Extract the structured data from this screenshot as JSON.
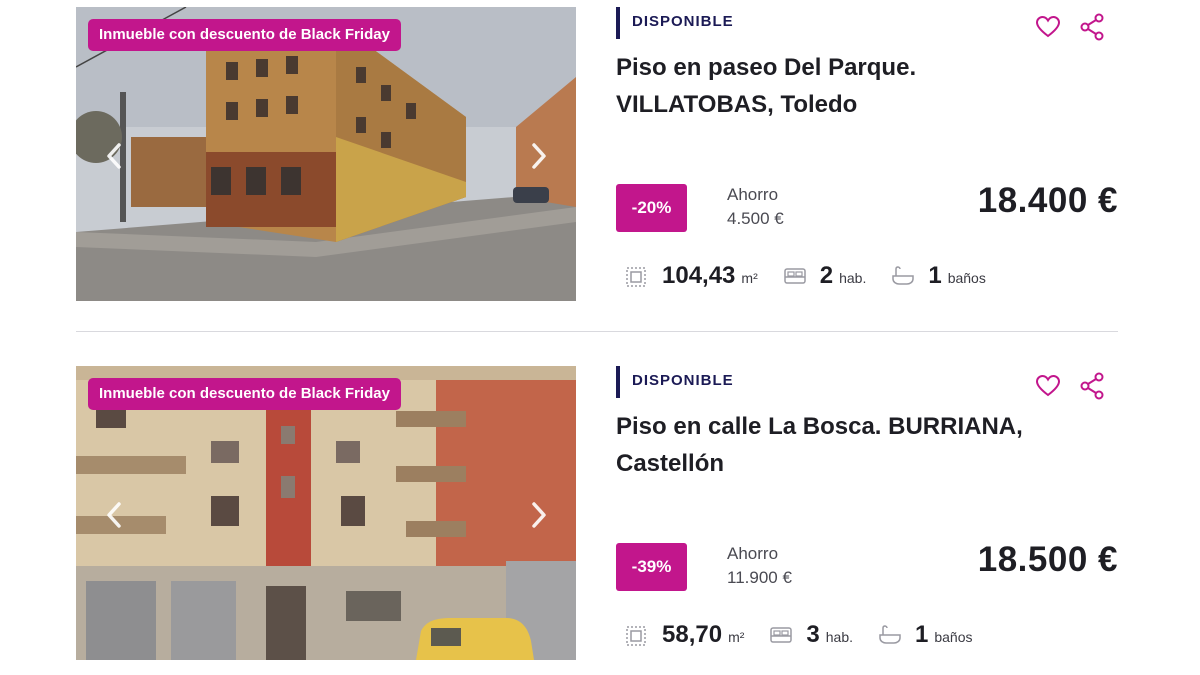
{
  "colors": {
    "accent": "#c2168c",
    "navy": "#1b1a55",
    "text": "#1e1e24"
  },
  "listings": [
    {
      "badge": "Inmueble con descuento de Black Friday",
      "status": "DISPONIBLE",
      "title": "Piso en paseo Del Parque. VILLATOBAS, Toledo",
      "discount": "-20%",
      "savings_label": "Ahorro",
      "savings_value": "4.500 €",
      "price": "18.400 €",
      "area_value": "104,43",
      "area_unit": "m²",
      "rooms_value": "2",
      "rooms_unit": "hab.",
      "baths_value": "1",
      "baths_unit": "baños",
      "icons": [
        "heart-icon",
        "share-icon",
        "area-icon",
        "bed-icon",
        "bath-icon",
        "chevron-left-icon",
        "chevron-right-icon"
      ]
    },
    {
      "badge": "Inmueble con descuento de Black Friday",
      "status": "DISPONIBLE",
      "title": "Piso en calle La Bosca. BURRIANA, Castellón",
      "discount": "-39%",
      "savings_label": "Ahorro",
      "savings_value": "11.900 €",
      "price": "18.500 €",
      "area_value": "58,70",
      "area_unit": "m²",
      "rooms_value": "3",
      "rooms_unit": "hab.",
      "baths_value": "1",
      "baths_unit": "baños",
      "icons": [
        "heart-icon",
        "share-icon",
        "area-icon",
        "bed-icon",
        "bath-icon",
        "chevron-left-icon",
        "chevron-right-icon"
      ]
    }
  ]
}
